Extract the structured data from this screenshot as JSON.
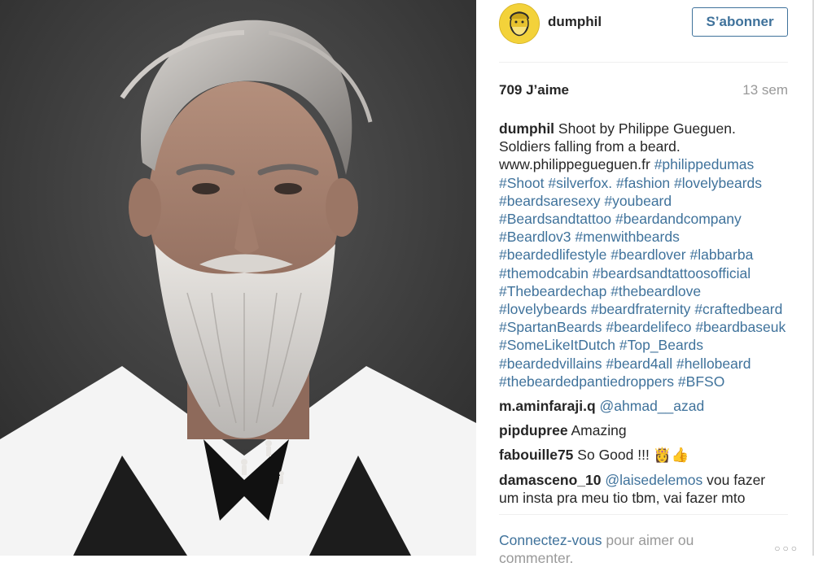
{
  "photo": {
    "alt_icon": "portrait-photo"
  },
  "header": {
    "username": "dumphil",
    "follow_label": "S’abonner",
    "avatar_icon": "avatar-illustration"
  },
  "stats": {
    "likes": "709 J’aime",
    "time": "13 sem"
  },
  "caption": {
    "username": "dumphil",
    "text": "Shoot by Philippe Gueguen. Soldiers falling from a beard. www.philippegueguen.fr",
    "tags": [
      "#philippedumas",
      "#Shoot",
      "#silverfox.",
      "#fashion",
      "#lovelybeards",
      "#beardsaresexy",
      "#youbeard",
      "#Beardsandtattoo",
      "#beardandcompany",
      "#Beardlov3",
      "#menwithbeards",
      "#beardedlifestyle",
      "#beardlover",
      "#labbarba",
      "#themodcabin",
      "#beardsandtattoosofficial",
      "#Thebeardechap",
      "#thebeardlove",
      "#lovelybeards",
      "#beardfraternity",
      "#craftedbeard",
      "#SpartanBeards",
      "#beardelifeco",
      "#beardbaseuk",
      "#SomeLikeItDutch",
      "#Top_Beards",
      "#beardedvillains",
      "#beard4all",
      "#hellobeard",
      "#thebeardedpantiedroppers",
      "#BFSO"
    ]
  },
  "comments": [
    {
      "username": "m.aminfaraji.q",
      "mention": "@ahmad__azad",
      "text": ""
    },
    {
      "username": "pipdupree",
      "mention": "",
      "text": "Amazing"
    },
    {
      "username": "fabouille75",
      "mention": "",
      "text": "So Good !!! 👸👍"
    },
    {
      "username": "damasceno_10",
      "mention": "@laisedelemos",
      "text": "vou fazer um insta pra meu tio tbm, vai fazer mto"
    }
  ],
  "footer": {
    "login_link": "Connectez-vous",
    "login_text": "pour aimer ou commenter.",
    "more_label": "○○○"
  },
  "colors": {
    "link": "#3f729b",
    "muted": "#999999",
    "text": "#262626"
  }
}
